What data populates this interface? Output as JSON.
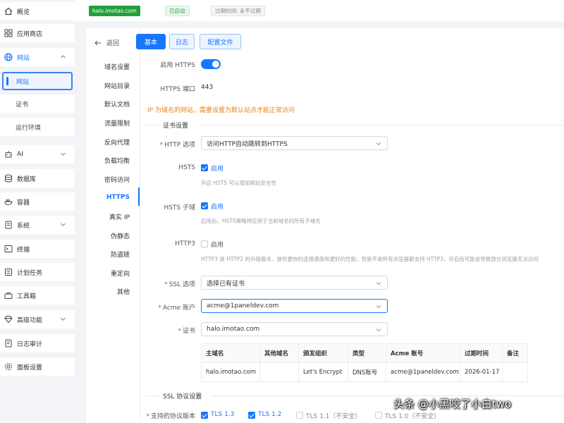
{
  "sidebar": {
    "items": [
      {
        "label": "概览",
        "icon": "home-icon"
      },
      {
        "label": "应用商店",
        "icon": "grid-icon"
      },
      {
        "label": "网站",
        "icon": "globe-icon"
      },
      {
        "label": "AI",
        "icon": "robot-icon"
      },
      {
        "label": "数据库",
        "icon": "database-icon"
      },
      {
        "label": "容器",
        "icon": "container-icon"
      },
      {
        "label": "系统",
        "icon": "system-icon"
      },
      {
        "label": "终端",
        "icon": "terminal-icon"
      },
      {
        "label": "计划任务",
        "icon": "task-icon"
      },
      {
        "label": "工具箱",
        "icon": "toolbox-icon"
      },
      {
        "label": "高级功能",
        "icon": "diamond-icon"
      },
      {
        "label": "日志审计",
        "icon": "log-icon"
      },
      {
        "label": "面板设置",
        "icon": "settings-icon"
      }
    ],
    "subitems": [
      "网站",
      "证书",
      "运行环境"
    ]
  },
  "topbar": {
    "domain": "halo.imotao.com",
    "status": "已启动",
    "expire": "过期时间: 永不过期"
  },
  "leftmenu": {
    "back": "返回",
    "items": [
      "域名设置",
      "网站目录",
      "默认文档",
      "流量限制",
      "反向代理",
      "负载均衡",
      "密码访问",
      "HTTPS",
      "真实 IP",
      "伪静态",
      "防盗链",
      "重定向",
      "其他"
    ],
    "active": "HTTPS"
  },
  "tabs": [
    "基本",
    "日志",
    "配置文件"
  ],
  "form": {
    "https_enable_label": "启用 HTTPS",
    "https_port_label": "HTTPS 端口",
    "https_port_value": "443",
    "ip_warning": "IP 为域名的网站，需要设置为默认站点才能正常访问",
    "cert_section": "证书设置",
    "http_option_label": "HTTP 选项",
    "http_option_value": "访问HTTP自动跳转到HTTPS",
    "hsts_label": "HSTS",
    "hsts_cb_label": "启用",
    "hsts_hint": "开启 HSTS 可以增加网站安全性",
    "hsts_sub_label": "HSTS 子域",
    "hsts_sub_cb_label": "启用",
    "hsts_sub_hint": "启用后，HSTS策略将应用于当前域名的所有子域名",
    "http3_label": "HTTP3",
    "http3_cb_label": "启用",
    "http3_hint": "HTTP3 是 HTTP2 的升级版本，提供更快的连接速度和更好的性能，但是不是所有浏览器都支持 HTTP3，开启后可能会导致部分浏览器无法访问",
    "ssl_option_label": "SSL 选项",
    "ssl_option_value": "选择已有证书",
    "acme_label": "Acme 账户",
    "acme_value": "acme@1paneldev.com",
    "cert_label": "证书",
    "cert_value": "halo.imotao.com",
    "ssl_section": "SSL 协议设置",
    "protocol_label": "支持的协议版本",
    "protocols": [
      {
        "label": "TLS 1.3",
        "checked": true
      },
      {
        "label": "TLS 1.2",
        "checked": true
      },
      {
        "label": "TLS 1.1（不安全）",
        "checked": false
      },
      {
        "label": "TLS 1.0（不安全）",
        "checked": false
      }
    ]
  },
  "cert_table": {
    "headers": [
      "主域名",
      "其他域名",
      "颁发组织",
      "类型",
      "Acme 账号",
      "过期时间",
      "备注"
    ],
    "row": [
      "halo.imotao.com",
      "",
      "Let's Encrypt",
      "DNS账号",
      "acme@1paneldev.com",
      "2026-01-17",
      ""
    ]
  },
  "watermark": "头条 @小黑咬了小白two",
  "colors": {
    "accent": "#1677ff",
    "success": "#22a03a",
    "warning": "#e8831e"
  }
}
